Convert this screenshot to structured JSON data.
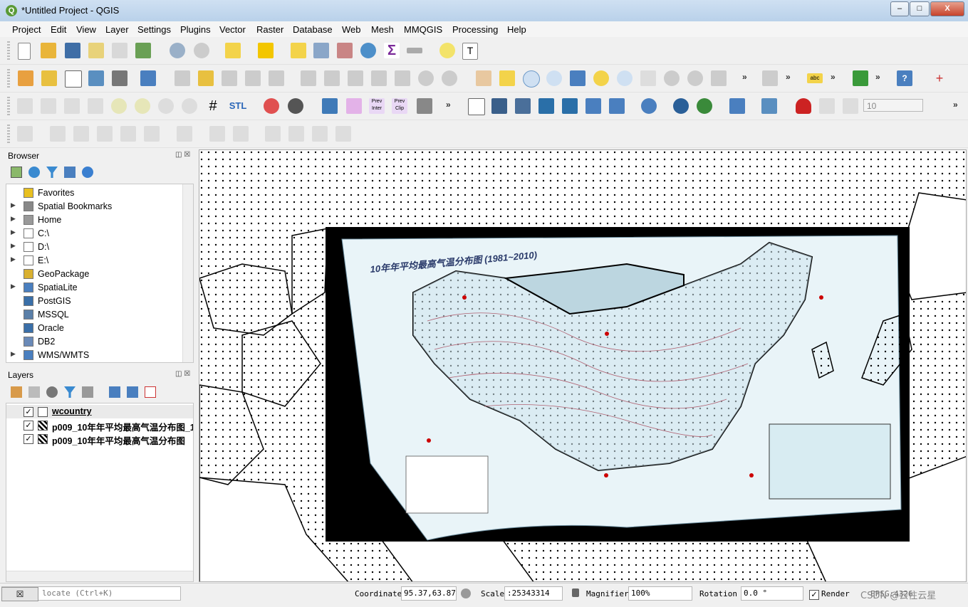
{
  "window": {
    "title": "*Untitled Project - QGIS",
    "min": "–",
    "max": "□",
    "close": "X"
  },
  "menu": [
    "Project",
    "Edit",
    "View",
    "Layer",
    "Settings",
    "Plugins",
    "Vector",
    "Raster",
    "Database",
    "Web",
    "Mesh",
    "MMQGIS",
    "Processing",
    "Help"
  ],
  "toolbar": {
    "prev_inter": "Prev Inter",
    "prev_clip": "Prev Clip",
    "stl_label": "STL",
    "abc_label": "abc",
    "snap_tolerance": "10",
    "more": "»"
  },
  "browser": {
    "title": "Browser",
    "items": [
      {
        "label": "Favorites",
        "icon": "star-icon",
        "expandable": false
      },
      {
        "label": "Spatial Bookmarks",
        "icon": "bookmark-icon",
        "expandable": true
      },
      {
        "label": "Home",
        "icon": "home-folder-icon",
        "expandable": true
      },
      {
        "label": "C:\\",
        "icon": "folder-icon",
        "expandable": true
      },
      {
        "label": "D:\\",
        "icon": "folder-icon",
        "expandable": true
      },
      {
        "label": "E:\\",
        "icon": "folder-icon",
        "expandable": true
      },
      {
        "label": "GeoPackage",
        "icon": "geopackage-icon",
        "expandable": false
      },
      {
        "label": "SpatiaLite",
        "icon": "spatialite-icon",
        "expandable": true
      },
      {
        "label": "PostGIS",
        "icon": "postgis-icon",
        "expandable": false
      },
      {
        "label": "MSSQL",
        "icon": "mssql-icon",
        "expandable": false
      },
      {
        "label": "Oracle",
        "icon": "oracle-icon",
        "expandable": false
      },
      {
        "label": "DB2",
        "icon": "db2-icon",
        "expandable": false
      },
      {
        "label": "WMS/WMTS",
        "icon": "wms-icon",
        "expandable": true
      }
    ]
  },
  "layers": {
    "title": "Layers",
    "items": [
      {
        "name": "wcountry",
        "checked": true,
        "underline": true
      },
      {
        "name": "p009_10年年平均最高气温分布图_1",
        "checked": true,
        "underline": false
      },
      {
        "name": "p009_10年年平均最高气温分布图",
        "checked": true,
        "underline": false
      }
    ]
  },
  "map": {
    "raster_title": "10年年平均最高气温分布图 (1981~2010)"
  },
  "status": {
    "locator_placeholder": "Type to locate (Ctrl+K)",
    "coordinate_label": "Coordinate",
    "coordinate_value": "95.37,63.87",
    "scale_label": "Scale",
    "scale_value": ":25343314",
    "magnifier_label": "Magnifier",
    "magnifier_value": "100%",
    "rotation_label": "Rotation",
    "rotation_value": "0.0 °",
    "render_label": "Render",
    "crs_label": "EPSG:4326",
    "watermark": "CSDN @云往云星"
  },
  "colors": {
    "accent": "#4a7fbf",
    "map_land_overlay": "#cfe6ee",
    "map_outline": "#000000"
  }
}
